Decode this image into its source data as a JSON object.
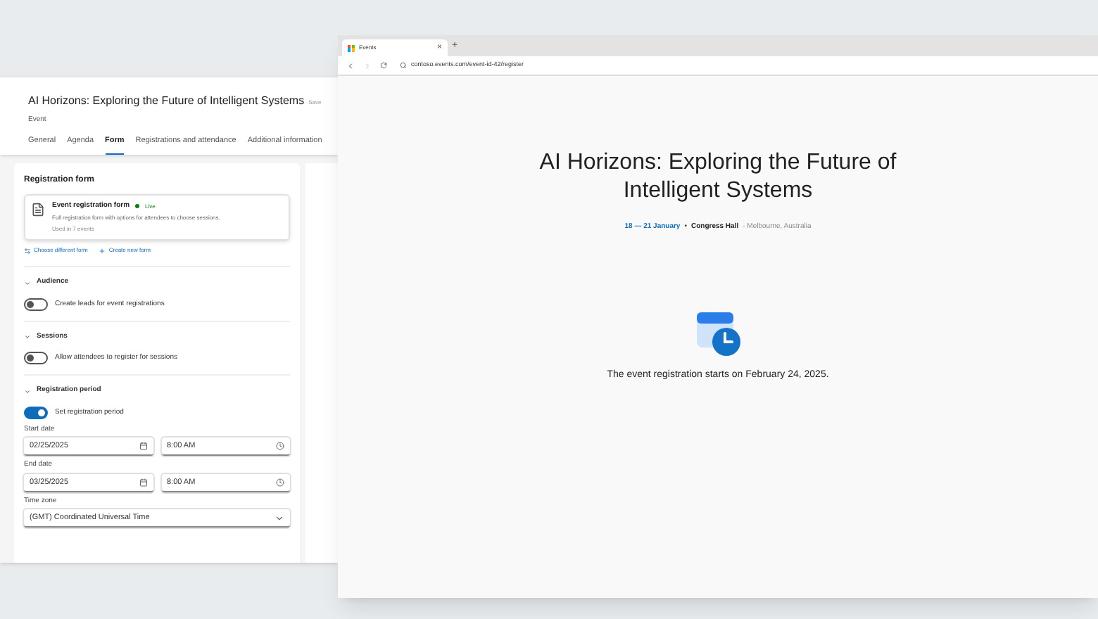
{
  "editor": {
    "title": "AI Horizons: Exploring the Future of Intelligent Systems",
    "save_status": "Save",
    "subtitle": "Event",
    "tabs": [
      {
        "label": "General",
        "selected": false
      },
      {
        "label": "Agenda",
        "selected": false
      },
      {
        "label": "Form",
        "selected": true
      },
      {
        "label": "Registrations and attendance",
        "selected": false
      },
      {
        "label": "Additional information",
        "selected": false
      }
    ],
    "section_title": "Registration form",
    "form_card": {
      "name": "Event registration form",
      "status": "Live",
      "description": "Full registration form with options for attendees to choose sessions.",
      "usage": "Used in 7 events"
    },
    "actions": [
      {
        "label": "Choose different form",
        "kind": "choose"
      },
      {
        "label": "Create new form",
        "kind": "create"
      }
    ],
    "groups": [
      {
        "title": "Audience",
        "expanded": true,
        "toggle": {
          "label": "Create leads for event registrations",
          "on": false
        }
      },
      {
        "title": "Sessions",
        "expanded": true,
        "toggle": {
          "label": "Allow attendees to register for sessions",
          "on": false
        }
      },
      {
        "title": "Registration period",
        "expanded": true,
        "toggle": {
          "label": "Set registration period",
          "on": true
        }
      }
    ],
    "start": {
      "label": "Start date",
      "date": "02/25/2025",
      "time": "8:00 AM"
    },
    "end": {
      "label": "End date",
      "date": "03/25/2025",
      "time": "8:00 AM"
    },
    "timezone": {
      "label": "Time zone",
      "value": "(GMT) Coordinated Universal Time"
    }
  },
  "browser": {
    "tab_title": "Events",
    "tab_close": "×",
    "new_tab": "+",
    "url": "contoso.events.com/event-id-42/register",
    "page": {
      "title": "AI Horizons: Exploring the Future of Intelligent Systems",
      "dates": "18 — 21 January",
      "separator": "•",
      "venue": "Congress Hall",
      "location": "- Melbourne, Australia",
      "message": "The event registration starts on February 24, 2025."
    }
  }
}
